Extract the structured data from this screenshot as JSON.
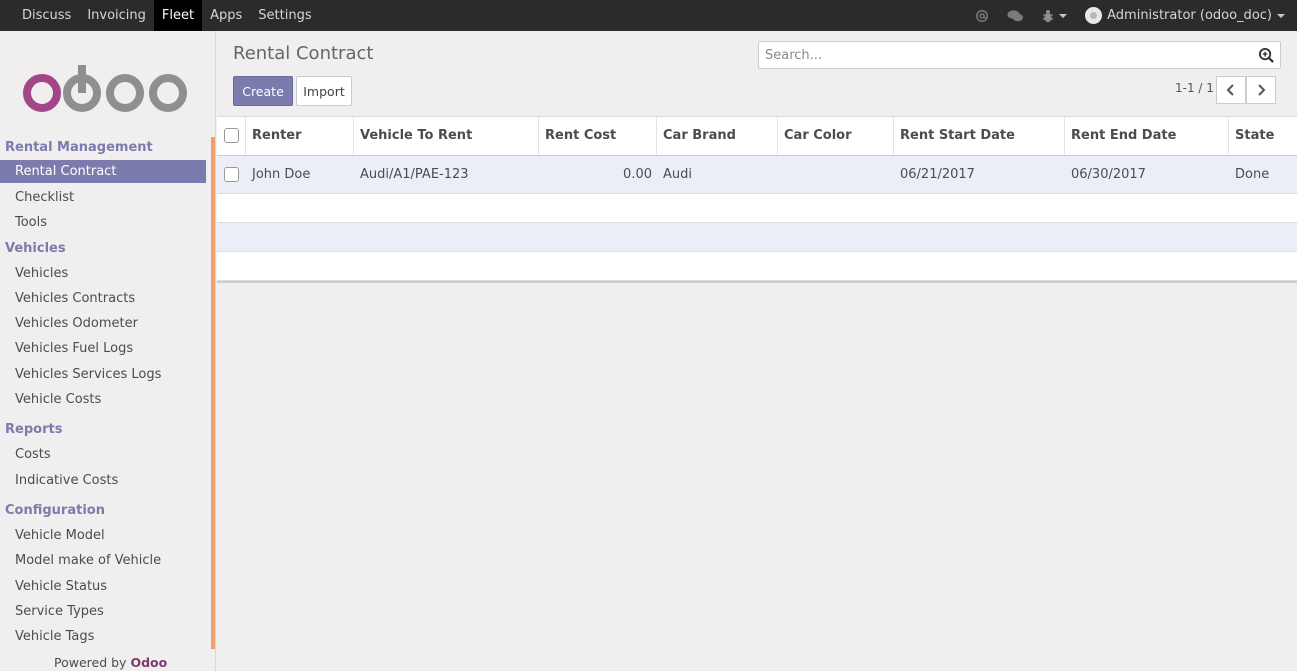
{
  "topbar": {
    "menu": [
      "Discuss",
      "Invoicing",
      "Fleet",
      "Apps",
      "Settings"
    ],
    "active": "Fleet",
    "user_label": "Administrator (odoo_doc)"
  },
  "sidebar": {
    "logo_text": "odoo",
    "sections": [
      {
        "title": "Rental Management",
        "items": [
          "Rental Contract",
          "Checklist",
          "Tools"
        ]
      },
      {
        "title": "Vehicles",
        "items": [
          "Vehicles",
          "Vehicles Contracts",
          "Vehicles Odometer",
          "Vehicles Fuel Logs",
          "Vehicles Services Logs",
          "Vehicle Costs"
        ]
      },
      {
        "title": "Reports",
        "items": [
          "Costs",
          "Indicative Costs"
        ]
      },
      {
        "title": "Configuration",
        "items": [
          "Vehicle Model",
          "Model make of Vehicle",
          "Vehicle Status",
          "Service Types",
          "Vehicle Tags"
        ]
      }
    ],
    "active_item": "Rental Contract",
    "powered_prefix": "Powered by",
    "powered_brand": "Odoo"
  },
  "main": {
    "title": "Rental Contract",
    "create_label": "Create",
    "import_label": "Import",
    "search_placeholder": "Search...",
    "pager": "1-1 / 1",
    "columns": [
      "Renter",
      "Vehicle To Rent",
      "Rent Cost",
      "Car Brand",
      "Car Color",
      "Rent Start Date",
      "Rent End Date",
      "State"
    ],
    "rows": [
      [
        "John Doe",
        "Audi/A1/PAE-123",
        "0.00",
        "Audi",
        "",
        "06/21/2017",
        "06/30/2017",
        "Done"
      ]
    ]
  },
  "colors": {
    "accent": "#7c7bad",
    "topbar": "#2b2b2b",
    "scrollbar": "#f0a06f"
  }
}
